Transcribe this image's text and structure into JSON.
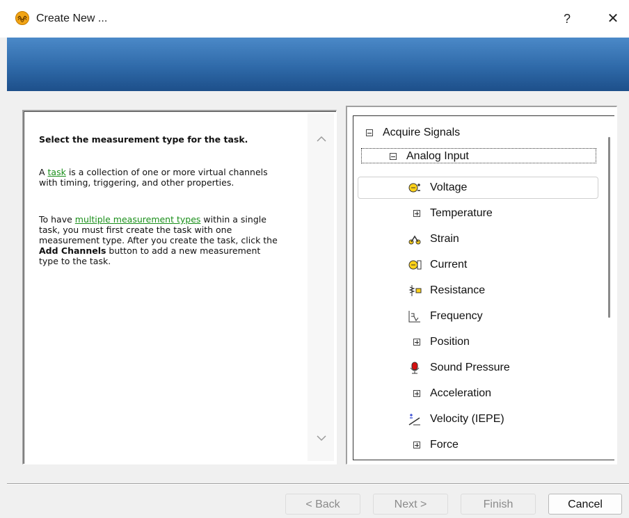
{
  "window": {
    "title": "Create New ...",
    "help_label": "?",
    "close_label": "✕"
  },
  "description": {
    "heading": "Select the measurement type for the task.",
    "p1_prefix": "A ",
    "p1_link": "task",
    "p1_suffix": " is a collection of one or more virtual channels with timing, triggering, and other properties.",
    "p2_prefix": "To have ",
    "p2_link": "multiple measurement types",
    "p2_mid": " within a single task, you must first create the task with one measurement type. After you create the task, click the ",
    "p2_bold": "Add Channels",
    "p2_suffix": " button to add a new measurement type to the task."
  },
  "tree": {
    "root": "Acquire Signals",
    "group": "Analog Input",
    "items": [
      {
        "label": "Voltage",
        "icon": "voltage-icon"
      },
      {
        "label": "Temperature",
        "icon": "expand-icon"
      },
      {
        "label": "Strain",
        "icon": "strain-icon"
      },
      {
        "label": "Current",
        "icon": "current-icon"
      },
      {
        "label": "Resistance",
        "icon": "resistance-icon"
      },
      {
        "label": "Frequency",
        "icon": "frequency-icon"
      },
      {
        "label": "Position",
        "icon": "expand-icon"
      },
      {
        "label": "Sound Pressure",
        "icon": "microphone-icon"
      },
      {
        "label": "Acceleration",
        "icon": "expand-icon"
      },
      {
        "label": "Velocity (IEPE)",
        "icon": "velocity-icon"
      },
      {
        "label": "Force",
        "icon": "expand-icon"
      }
    ]
  },
  "buttons": {
    "back": "< Back",
    "next": "Next >",
    "finish": "Finish",
    "cancel": "Cancel"
  },
  "colors": {
    "banner_top": "#4b89c8",
    "banner_bottom": "#1d4f8a",
    "link": "#1a8f1a"
  }
}
